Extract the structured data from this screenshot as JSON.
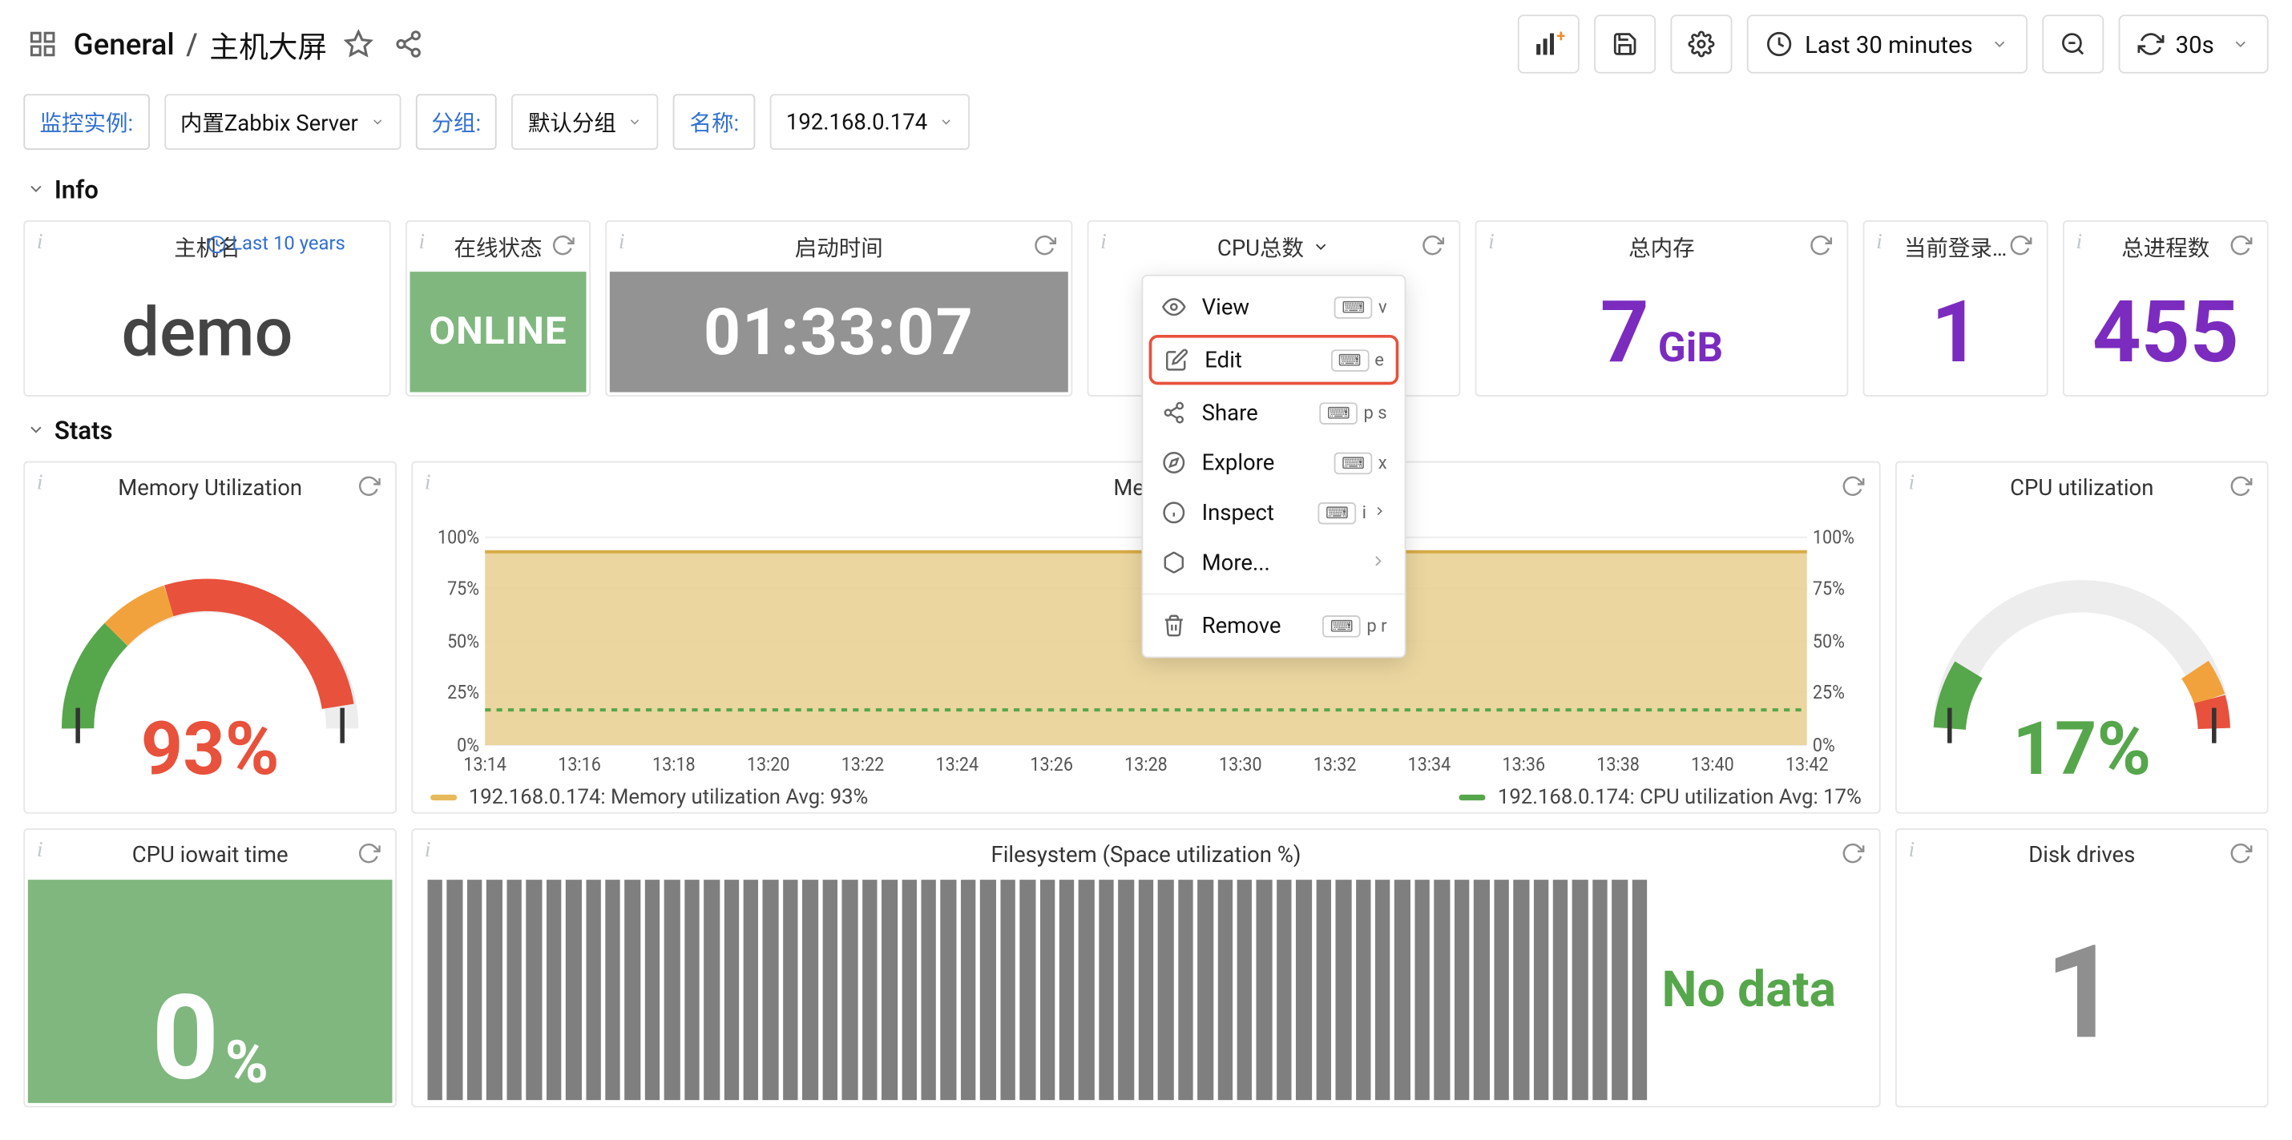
{
  "breadcrumb": {
    "folder": "General",
    "title": "主机大屏"
  },
  "toolbar": {
    "time_range": "Last 30 minutes",
    "refresh_interval": "30s"
  },
  "filters": {
    "instance_label": "监控实例:",
    "instance_value": "内置Zabbix Server",
    "group_label": "分组:",
    "group_value": "默认分组",
    "name_label": "名称:",
    "name_value": "192.168.0.174"
  },
  "sections": {
    "info": "Info",
    "stats": "Stats"
  },
  "info": {
    "host": {
      "title": "主机名",
      "value": "demo",
      "extra": "Last 10 years"
    },
    "online": {
      "title": "在线状态",
      "value": "ONLINE"
    },
    "uptime": {
      "title": "启动时间",
      "value": "01:33:07"
    },
    "cpucount": {
      "title": "CPU总数"
    },
    "mem": {
      "title": "总内存",
      "value": "7",
      "unit": "GiB"
    },
    "login": {
      "title": "当前登录…",
      "value": "1"
    },
    "proc": {
      "title": "总进程数",
      "value": "455"
    }
  },
  "menu": {
    "view": {
      "label": "View",
      "key": "v"
    },
    "edit": {
      "label": "Edit",
      "key": "e"
    },
    "share": {
      "label": "Share",
      "key": "p s"
    },
    "explore": {
      "label": "Explore",
      "key": "x"
    },
    "inspect": {
      "label": "Inspect",
      "key": "i"
    },
    "more": {
      "label": "More..."
    },
    "remove": {
      "label": "Remove",
      "key": "p r"
    }
  },
  "stats": {
    "memutil": {
      "title": "Memory Utilization",
      "value": "93%",
      "pct": 93
    },
    "cpuutil": {
      "title": "CPU utilization",
      "value": "17%",
      "pct": 17
    },
    "ts": {
      "title": "Mem…",
      "legend_mem": "192.168.0.174: Memory utilization  Avg: 93%",
      "legend_cpu": "192.168.0.174: CPU utilization  Avg: 17%"
    }
  },
  "chart_data": {
    "type": "line",
    "x": [
      "13:14",
      "13:16",
      "13:18",
      "13:20",
      "13:22",
      "13:24",
      "13:26",
      "13:28",
      "13:30",
      "13:32",
      "13:34",
      "13:36",
      "13:38",
      "13:40",
      "13:42"
    ],
    "series": [
      {
        "name": "192.168.0.174: Memory utilization",
        "color": "#e6c77a",
        "fill": true,
        "values": [
          93,
          93,
          93,
          93,
          93,
          93,
          93,
          93,
          93,
          93,
          93,
          93,
          93,
          93,
          93
        ]
      },
      {
        "name": "192.168.0.174: CPU utilization",
        "color": "#56a64b",
        "dashed": true,
        "values": [
          17,
          17,
          17,
          17,
          17,
          17,
          17,
          17,
          17,
          17,
          17,
          17,
          17,
          17,
          17
        ]
      }
    ],
    "ylabel": "%",
    "ylim": [
      0,
      100
    ],
    "yticks": [
      0,
      25,
      50,
      75,
      100
    ]
  },
  "bottom": {
    "iowait": {
      "title": "CPU iowait time",
      "value": "0",
      "unit": "%"
    },
    "fs": {
      "title": "Filesystem (Space utilization %)",
      "nodata": "No data"
    },
    "dd": {
      "title": "Disk drives",
      "value": "1"
    }
  }
}
